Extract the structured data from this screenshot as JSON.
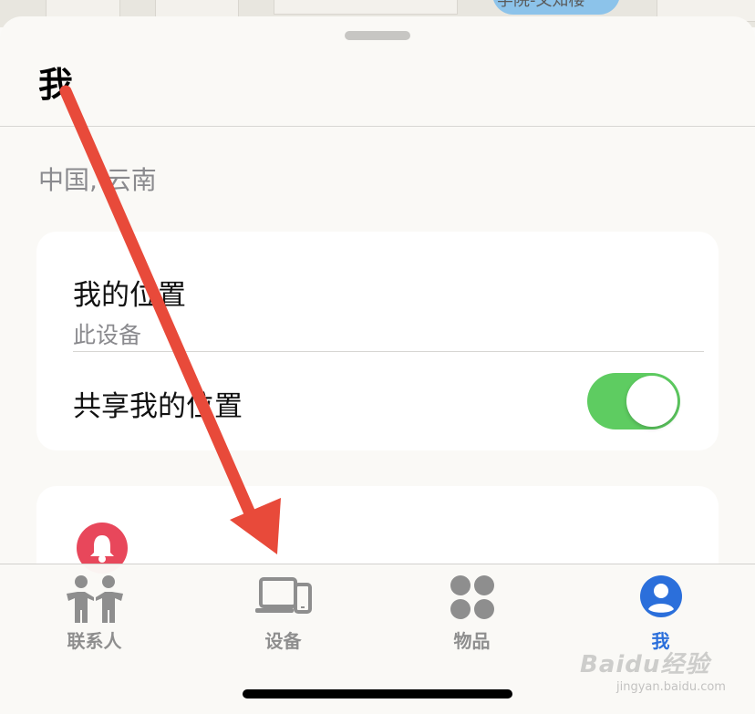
{
  "map": {
    "poi_label": "学院-文知楼"
  },
  "sheet": {
    "title": "我"
  },
  "location": {
    "region": "中国, 云南"
  },
  "my_location": {
    "title": "我的位置",
    "subtitle": "此设备",
    "share_label": "共享我的位置",
    "share_enabled": true
  },
  "tabs": [
    {
      "label": "联系人",
      "icon": "people-icon",
      "active": false
    },
    {
      "label": "设备",
      "icon": "devices-icon",
      "active": false
    },
    {
      "label": "物品",
      "icon": "items-icon",
      "active": false
    },
    {
      "label": "我",
      "icon": "person-circle-icon",
      "active": true
    }
  ],
  "colors": {
    "accent": "#2b6fdb",
    "toggle_on": "#5ecc61",
    "bell": "#e8475b",
    "annotation_arrow": "#e84a3a"
  },
  "watermark": {
    "brand": "Baidu经验",
    "url": "jingyan.baidu.com"
  }
}
